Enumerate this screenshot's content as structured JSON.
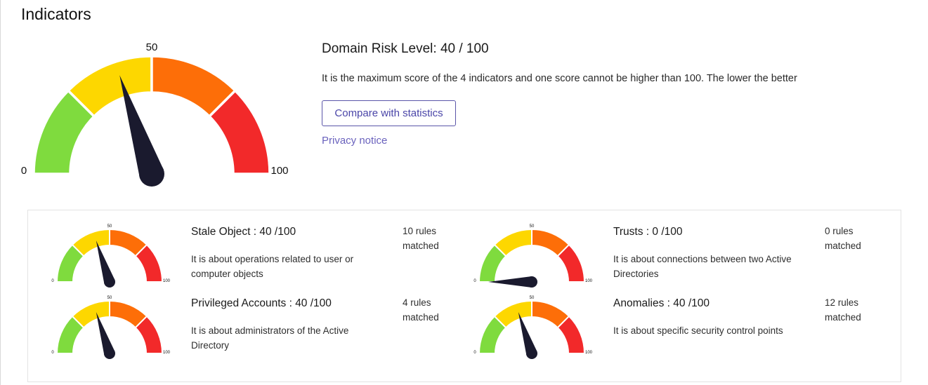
{
  "page": {
    "title": "Indicators"
  },
  "colors": {
    "green": "#7fdb3e",
    "yellow": "#fdd700",
    "orange": "#fd6e08",
    "red": "#f2292a",
    "needle": "#1a1a2e",
    "accent": "#5a55a8"
  },
  "main": {
    "score": 40,
    "max": 100,
    "label_min": "0",
    "label_mid": "50",
    "label_max": "100",
    "title": "Domain Risk Level: 40 / 100",
    "description": "It is the maximum score of the 4 indicators and one score cannot be higher than 100. The lower the better",
    "compare_button": "Compare with statistics",
    "privacy_link": "Privacy notice"
  },
  "indicators": [
    {
      "score": 40,
      "title": "Stale Object : 40 /100",
      "description": "It is about operations related to user or computer objects",
      "rules_line1": "10 rules",
      "rules_line2": "matched"
    },
    {
      "score": 0,
      "title": "Trusts : 0 /100",
      "description": "It is about connections between two Active Directories",
      "rules_line1": "0 rules",
      "rules_line2": "matched"
    },
    {
      "score": 40,
      "title": "Privileged Accounts : 40 /100",
      "description": "It is about administrators of the Active Directory",
      "rules_line1": "4 rules",
      "rules_line2": "matched"
    },
    {
      "score": 40,
      "title": "Anomalies : 40 /100",
      "description": "It is about specific security control points",
      "rules_line1": "12 rules",
      "rules_line2": "matched"
    }
  ]
}
